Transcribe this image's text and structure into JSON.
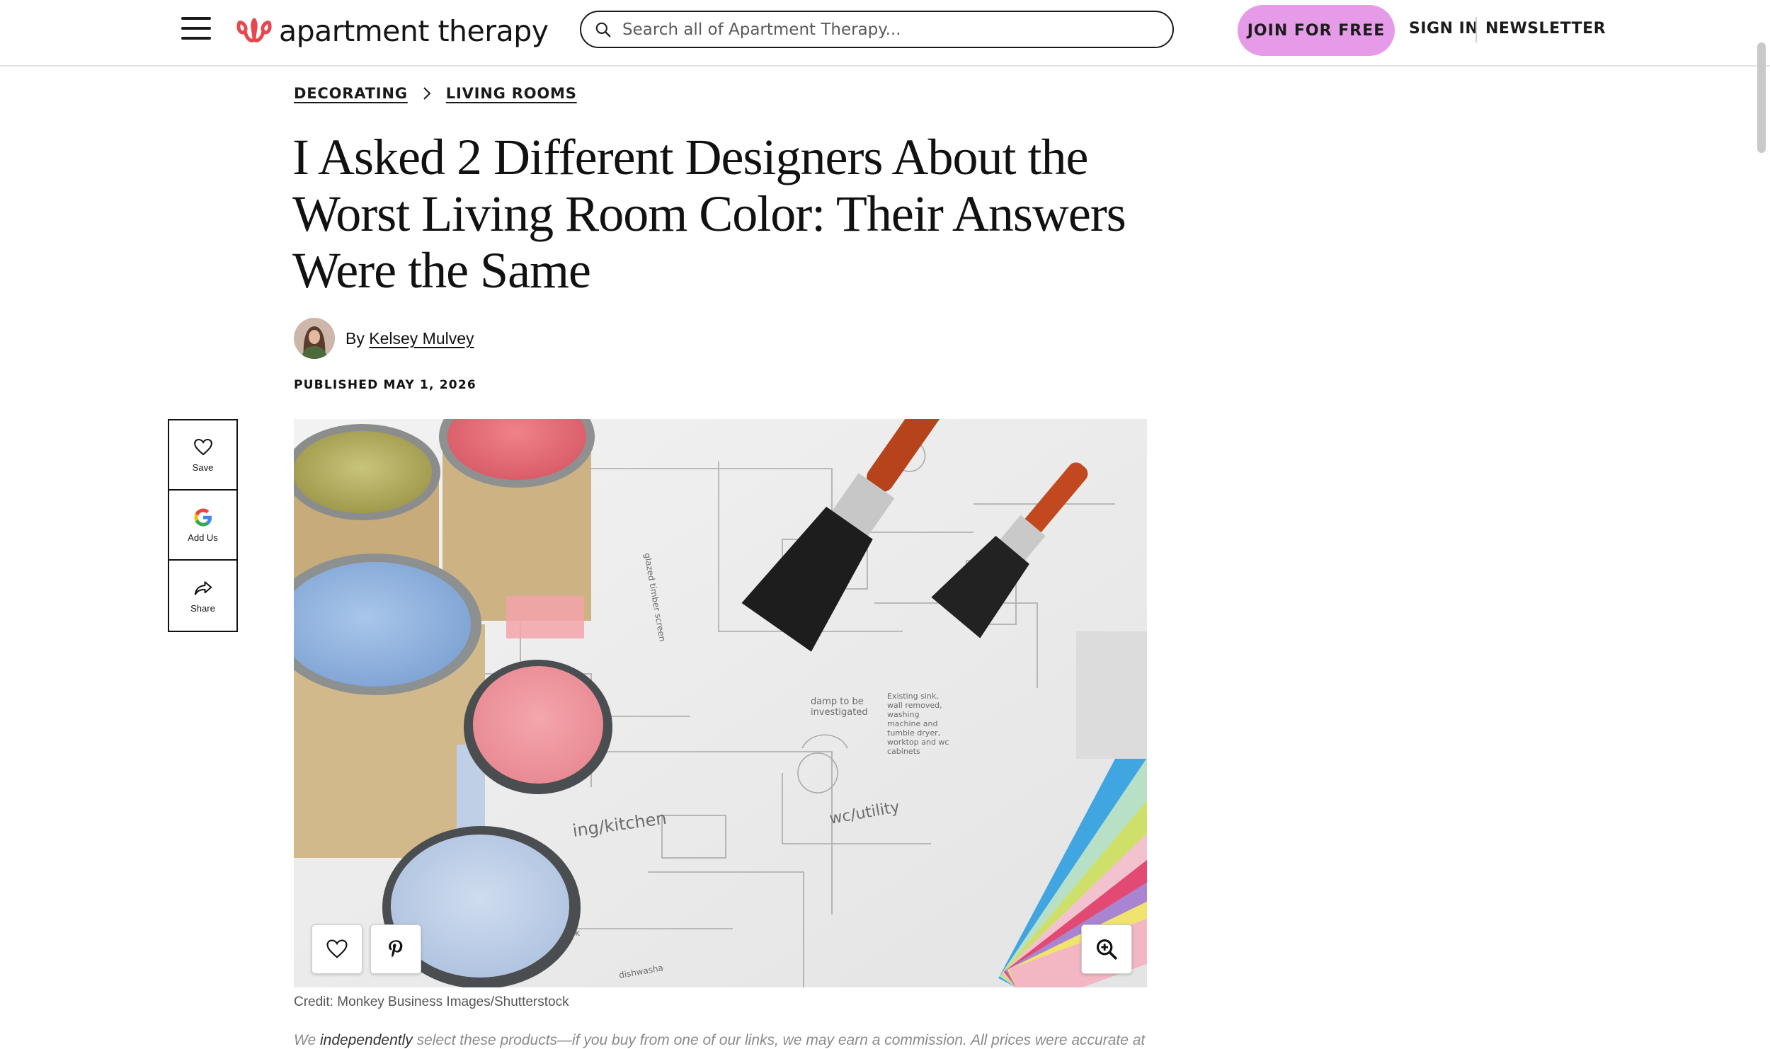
{
  "header": {
    "logo_text": "apartment therapy",
    "search_placeholder": "Search all of Apartment Therapy...",
    "join_label": "JOIN FOR FREE",
    "sign_in_label": "SIGN IN",
    "newsletter_label": "NEWSLETTER"
  },
  "breadcrumb": {
    "items": [
      "DECORATING",
      "LIVING ROOMS"
    ]
  },
  "article": {
    "title": "I Asked 2 Different Designers About the Worst Living Room Color: Their Answers Were the Same",
    "byline_prefix": "By",
    "author": "Kelsey Mulvey",
    "published": "PUBLISHED MAY 1, 2026",
    "image_credit": "Credit: Monkey Business Images/Shutterstock",
    "disclaimer_prefix": "We ",
    "disclaimer_emphasis": "independently",
    "disclaimer_rest": " select these products—if you buy from one of our links, we may earn a commission. All prices were accurate at"
  },
  "side_rail": {
    "save_label": "Save",
    "add_us_label": "Add Us",
    "share_label": "Share"
  },
  "image_overlay": {
    "icons": [
      "heart-icon",
      "pinterest-icon",
      "zoom-in-icon"
    ],
    "text": {
      "l1": "damp to be investigated",
      "l2": "Existing sink, wall removed, washing machine and tumble dryer, worktop and wc cabinets",
      "l3": "ing/kitchen",
      "l4": "wc/utility",
      "l5": "glazed timber screen",
      "l6": "sink",
      "l7": "dishwasha"
    }
  },
  "colors": {
    "accent_pink": "#e59be8",
    "logo_red": "#e8464e",
    "text_dark": "#111111",
    "muted_gray": "#8a8a8a"
  }
}
